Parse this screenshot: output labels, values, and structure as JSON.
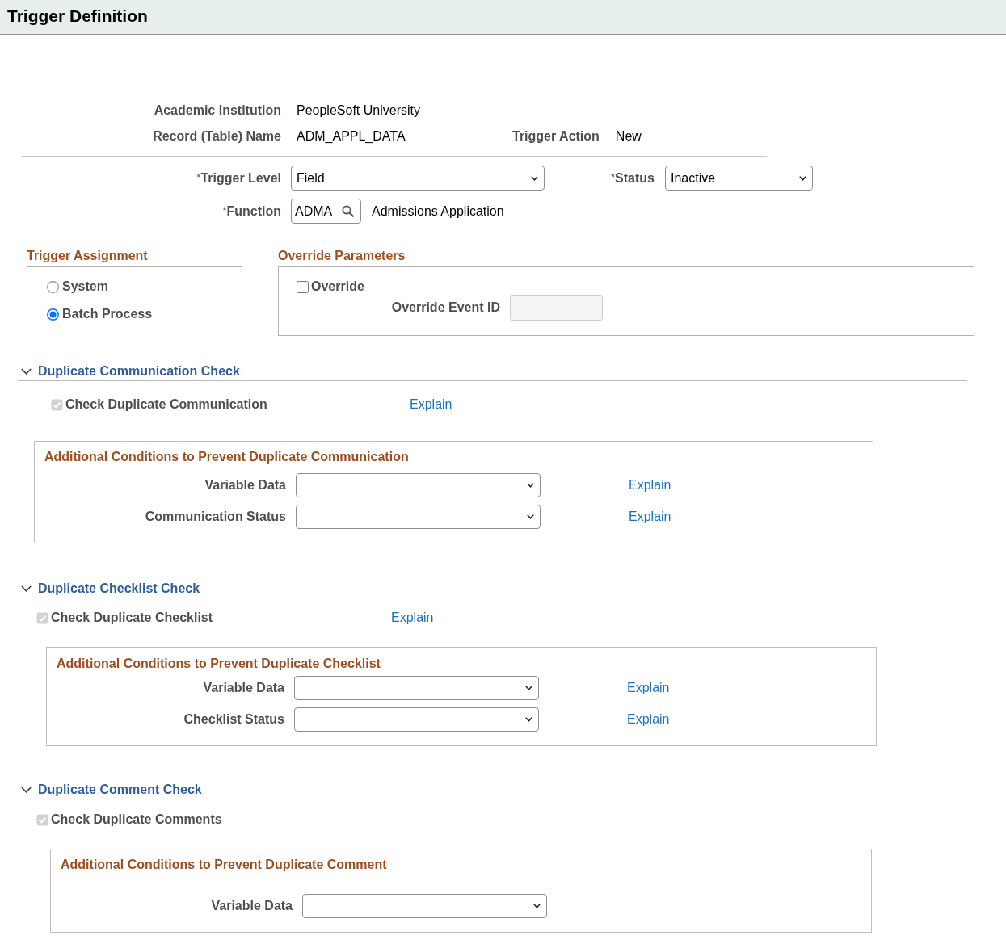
{
  "header": {
    "title": "Trigger Definition"
  },
  "info": {
    "institution": {
      "label": "Academic Institution",
      "value": "PeopleSoft University"
    },
    "record_name": {
      "label": "Record (Table) Name",
      "value": "ADM_APPL_DATA"
    },
    "trigger_action": {
      "label": "Trigger Action",
      "value": "New"
    }
  },
  "trigger_level": {
    "label": "$^{*}$Trigger Level",
    "value": "Field"
  },
  "status": {
    "label": "$^{*}$Status",
    "value": "Inactive"
  },
  "function": {
    "label": "$^{*}$Function",
    "value": "ADMA",
    "description": "Admissions Application"
  },
  "trigger_assignment": {
    "title": "Trigger Assignment",
    "options": [
      {
        "label": "System",
        "selected": false
      },
      {
        "label": "Batch Process",
        "selected": true
      }
    ]
  },
  "override_parameters": {
    "title": "Override Parameters",
    "override": {
      "label": "Override",
      "checked": false
    },
    "event_id": {
      "label": "Override Event ID",
      "disabled": true
    }
  },
  "sections": [
    {
      "title": "Duplicate Communication Check",
      "expanded": true,
      "check": {
        "label": "Check Duplicate Communication",
        "checked": true,
        "disabled": true
      },
      "explain": "Explain",
      "conditions": {
        "title": "Additional Conditions to Prevent Duplicate Communication",
        "rows": [
          {
            "label": "Variable Data",
            "explain": "Explain"
          },
          {
            "label": "Communication Status",
            "explain": "Explain"
          }
        ]
      }
    },
    {
      "title": "Duplicate Checklist Check",
      "expanded": true,
      "check": {
        "label": "Check Duplicate Checklist",
        "checked": true,
        "disabled": true
      },
      "explain": "Explain",
      "conditions": {
        "title": "Additional Conditions to Prevent Duplicate Checklist",
        "rows": [
          {
            "label": "Variable Data",
            "explain": "Explain"
          },
          {
            "label": "Checklist Status",
            "explain": "Explain"
          }
        ]
      }
    },
    {
      "title": "Duplicate Comment Check",
      "expanded": true,
      "check": {
        "label": "Check Duplicate Comments",
        "checked": true,
        "disabled": true
      },
      "conditions": {
        "title": "Additional Conditions to Prevent Duplicate Comment",
        "rows": [
          {
            "label": "Variable Data"
          }
        ]
      }
    }
  ]
}
